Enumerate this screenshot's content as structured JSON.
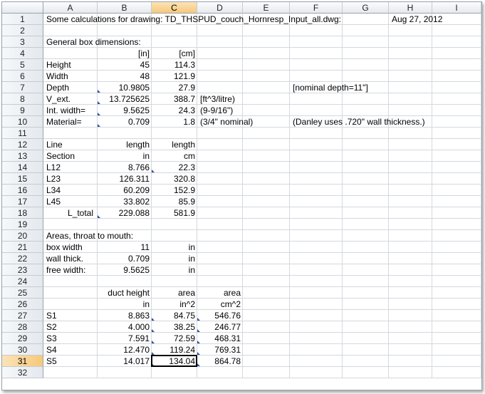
{
  "columns": [
    "A",
    "B",
    "C",
    "D",
    "E",
    "F",
    "G",
    "H",
    "I"
  ],
  "selected_column": "C",
  "selected_row": "31",
  "rows": [
    "1",
    "2",
    "3",
    "4",
    "5",
    "6",
    "7",
    "8",
    "9",
    "10",
    "11",
    "12",
    "13",
    "14",
    "15",
    "16",
    "17",
    "18",
    "19",
    "20",
    "21",
    "22",
    "23",
    "24",
    "25",
    "26",
    "27",
    "28",
    "29",
    "30",
    "31",
    "32"
  ],
  "cells": {
    "A1": "Some calculations for drawing: TD_THSPUD_couch_Hornresp_Input_all.dwg:",
    "H1": "Aug 27, 2012",
    "A3": "General box dimensions:",
    "B4": "[in]",
    "C4": "[cm]",
    "A5": "Height",
    "B5": "45",
    "C5": "114.3",
    "A6": "Width",
    "B6": "48",
    "C6": "121.9",
    "A7": "Depth",
    "B7": "10.9805",
    "C7": "27.9",
    "F7": "[nominal depth=11\"]",
    "A8": "V_ext.",
    "B8": "13.725625",
    "C8": "388.7",
    "D8": "[ft^3/litre)",
    "A9": "Int. width=",
    "B9": "9.5625",
    "C9": "24.3",
    "D9": "(9-9/16\")",
    "A10": "Material=",
    "B10": "0.709",
    "C10": "1.8",
    "D10": "(3/4\" nominal)",
    "F10": "(Danley uses .720\" wall thickness.)",
    "A12": "Line",
    "B12": "length",
    "C12": "length",
    "A13": "Section",
    "B13": "in",
    "C13": "cm",
    "A14": "L12",
    "B14": "8.766",
    "C14": "22.3",
    "A15": "L23",
    "B15": "126.311",
    "C15": "320.8",
    "A16": "L34",
    "B16": "60.209",
    "C16": "152.9",
    "A17": "L45",
    "B17": "33.802",
    "C17": "85.9",
    "A18": "L_total",
    "B18": "229.088",
    "C18": "581.9",
    "A20": "Areas, throat to mouth:",
    "A21": "box width",
    "B21": "11",
    "C21": "in",
    "A22": "wall thick.",
    "B22": "0.709",
    "C22": "in",
    "A23": "free width:",
    "B23": "9.5625",
    "C23": "in",
    "B25": "duct height",
    "C25": "area",
    "D25": "area",
    "B26": "in",
    "C26": "in^2",
    "D26": "cm^2",
    "A27": "S1",
    "B27": "8.863",
    "C27": "84.75",
    "D27": "546.76",
    "A28": "S2",
    "B28": "4.000",
    "C28": "38.25",
    "D28": "246.77",
    "A29": "S3",
    "B29": "7.591",
    "C29": "72.59",
    "D29": "468.31",
    "A30": "S4",
    "B30": "12.470",
    "C30": "119.24",
    "D30": "769.31",
    "A31": "S5",
    "B31": "14.017",
    "C31": "134.04",
    "D31": "864.78"
  }
}
